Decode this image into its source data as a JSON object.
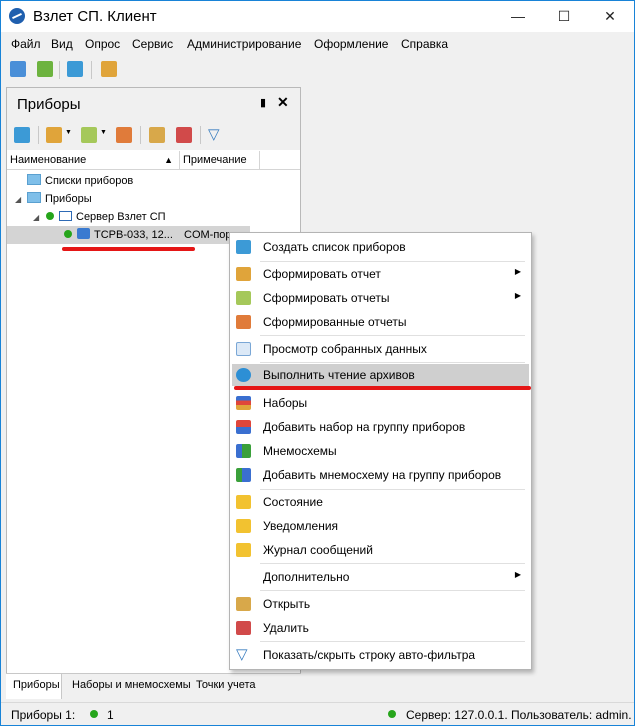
{
  "window": {
    "title": "Взлет СП. Клиент"
  },
  "menu": [
    "Файл",
    "Вид",
    "Опрос",
    "Сервис",
    "Администрирование",
    "Оформление",
    "Справка"
  ],
  "panel": {
    "title": "Приборы",
    "columns": [
      "Наименование",
      "Примечание"
    ],
    "tree": [
      {
        "label": "Списки приборов"
      },
      {
        "label": "Приборы"
      },
      {
        "label": "Сервер Взлет СП"
      },
      {
        "label": "ТСРВ-033, 12...",
        "note": "COM-порт..."
      }
    ],
    "tabs": [
      "Приборы",
      "Наборы и мнемосхемы",
      "Точки учета"
    ]
  },
  "context_menu": {
    "items": [
      "Создать список приборов",
      "Сформировать отчет",
      "Сформировать отчеты",
      "Сформированные отчеты",
      "Просмотр собранных данных",
      "Выполнить чтение архивов",
      "Наборы",
      "Добавить набор на группу приборов",
      "Мнемосхемы",
      "Добавить мнемосхему на группу приборов",
      "Состояние",
      "Уведомления",
      "Журнал сообщений",
      "Дополнительно",
      "Открыть",
      "Удалить",
      "Показать/скрыть строку авто-фильтра"
    ]
  },
  "status": {
    "devices_label": "Приборы 1:",
    "devices_count": "1",
    "server": "Сервер: 127.0.0.1. Пользователь: admin."
  },
  "colors": {
    "accent": "#1883d7",
    "ok": "#26a51b",
    "highlight_mark": "#e51616"
  }
}
